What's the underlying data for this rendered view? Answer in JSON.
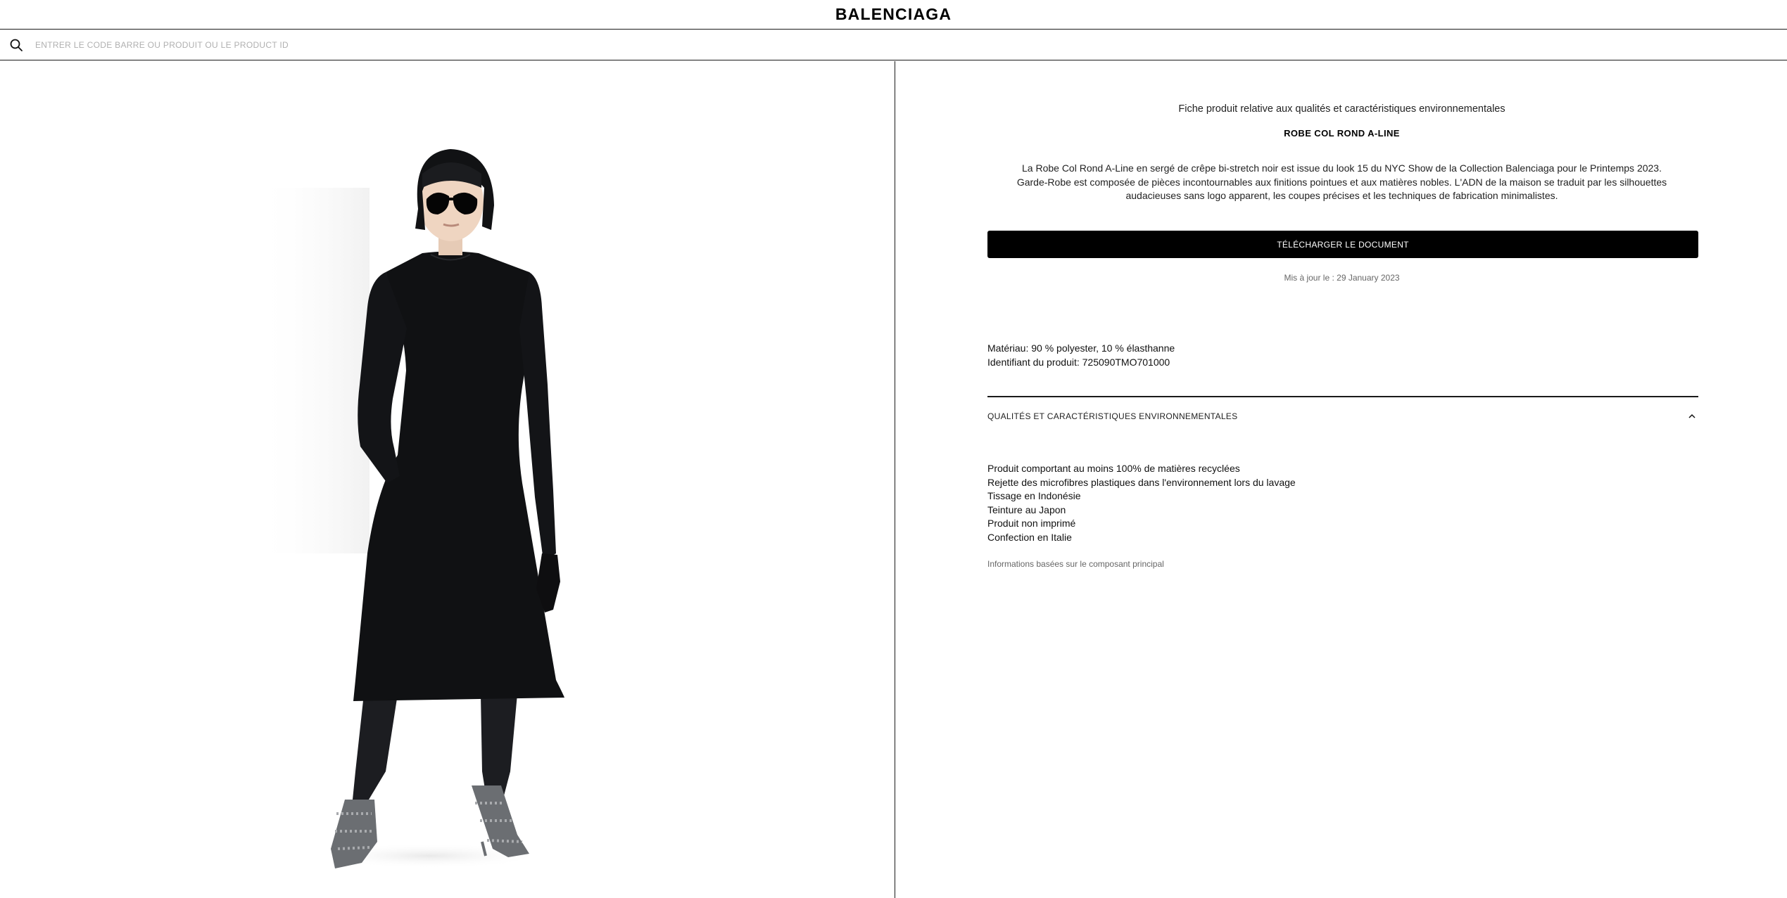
{
  "header": {
    "logo": "BALENCIAGA"
  },
  "search": {
    "icon": "search-icon",
    "placeholder": "ENTRER LE CODE BARRE OU PRODUIT OU LE PRODUCT ID",
    "value": ""
  },
  "product": {
    "image_subject": "model-in-black-a-line-dress",
    "sheet_title": "Fiche produit relative aux qualités et caractéristiques environnementales",
    "name": "ROBE COL ROND A-LINE",
    "description_lines": [
      "La Robe Col Rond A-Line en sergé de crêpe bi-stretch noir est issue du look 15 du NYC Show de la Collection Balenciaga pour le Printemps 2023.",
      "Garde-Robe est composée de pièces incontournables aux finitions pointues et aux matières nobles. L'ADN de la maison se traduit par les silhouettes",
      "audacieuses sans logo apparent, les coupes précises et les techniques de fabrication minimalistes."
    ],
    "download_label": "TÉLÉCHARGER LE DOCUMENT",
    "updated": "Mis à jour le : 29 January 2023",
    "material": "Matériau: 90 % polyester, 10 % élasthanne",
    "product_id": "Identifiant du produit: 725090TMO701000"
  },
  "accordion": {
    "title": "QUALITÉS ET CARACTÉRISTIQUES ENVIRONNEMENTALES",
    "expanded": true,
    "icon": "chevron-up-icon",
    "items": [
      "Produit comportant au moins 100% de matières recyclées",
      "Rejette des microfibres plastiques dans l'environnement lors du lavage",
      "Tissage en Indonésie",
      "Teinture au Japon",
      "Produit non imprimé",
      "Confection en Italie"
    ],
    "footnote": "Informations basées sur le composant principal"
  },
  "colors": {
    "background": "#ffffff",
    "text": "#111111",
    "button_bg": "#000000",
    "button_text": "#ffffff",
    "border": "#1a1a1a"
  }
}
